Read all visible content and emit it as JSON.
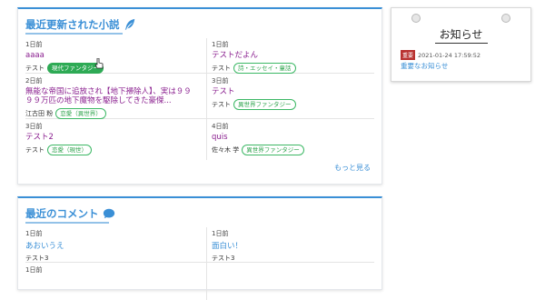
{
  "novels": {
    "title": "最近更新された小説",
    "more_label": "もっと見る",
    "items": [
      {
        "time": "1日前",
        "title": "aaaa",
        "author": "テスト",
        "tag": "現代ファンタジー",
        "tag_filled": true
      },
      {
        "time": "1日前",
        "title": "テストだよん",
        "author": "テスト",
        "tag": "詩・エッセイ・童話"
      },
      {
        "time": "2日前",
        "title": "無能な帝国に追放され【地下掃除人】、実は９９９９万匹の地下魔物を駆除してきた豪傑...",
        "author": "江古田 粉",
        "tag": "恋愛（異世界）"
      },
      {
        "time": "3日前",
        "title": "テスト",
        "author": "テスト",
        "tag": "異世界ファンタジー"
      },
      {
        "time": "3日前",
        "title": "テスト2",
        "author": "テスト",
        "tag": "恋愛（現世）"
      },
      {
        "time": "4日前",
        "title": "quis",
        "author": "佐々木 学",
        "tag": "異世界ファンタジー"
      }
    ]
  },
  "comments": {
    "title": "最近のコメント",
    "items": [
      {
        "time": "1日前",
        "text": "あおいうえ",
        "author": "テスト3"
      },
      {
        "time": "1日前",
        "text": "面白い！",
        "author": "テスト3"
      },
      {
        "time": "1日前"
      }
    ]
  },
  "notice": {
    "title": "お知らせ",
    "badge": "重要",
    "datetime": "2021-01-24 17:59:52",
    "link": "重要なお知らせ"
  }
}
